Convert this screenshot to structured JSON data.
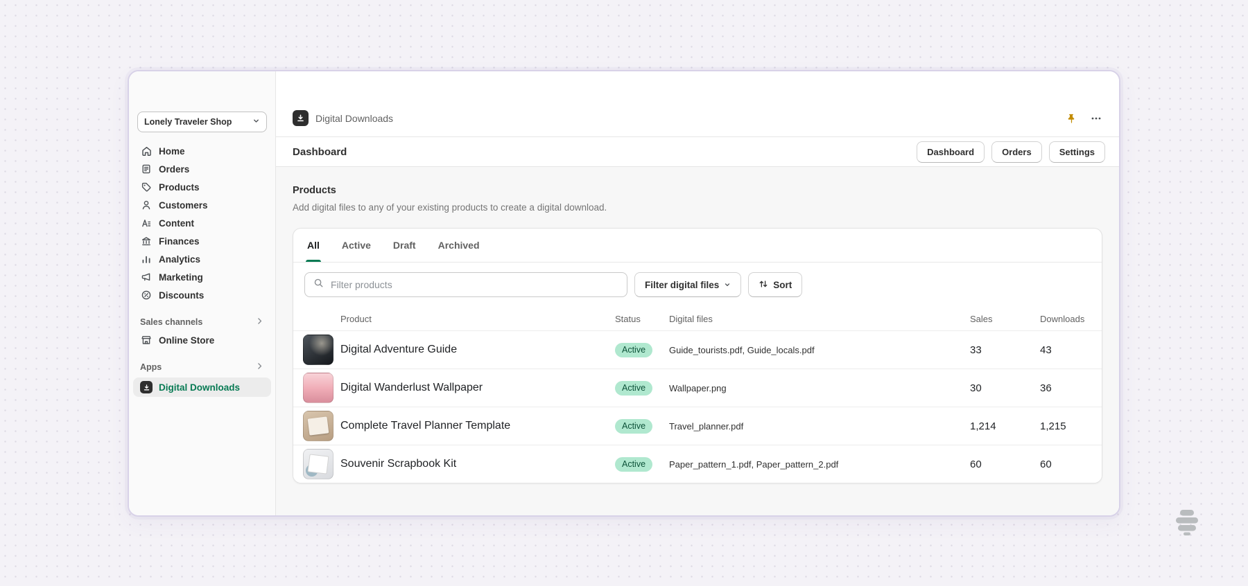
{
  "window": {
    "sidebar": {
      "store_selector": "Lonely Traveler Shop",
      "nav": [
        {
          "label": "Home",
          "icon": "home-icon"
        },
        {
          "label": "Orders",
          "icon": "orders-icon"
        },
        {
          "label": "Products",
          "icon": "products-icon"
        },
        {
          "label": "Customers",
          "icon": "customers-icon"
        },
        {
          "label": "Content",
          "icon": "content-icon"
        },
        {
          "label": "Finances",
          "icon": "finances-icon"
        },
        {
          "label": "Analytics",
          "icon": "analytics-icon"
        },
        {
          "label": "Marketing",
          "icon": "marketing-icon"
        },
        {
          "label": "Discounts",
          "icon": "discounts-icon"
        }
      ],
      "sales_channels": {
        "label": "Sales channels",
        "items": [
          "Online Store"
        ]
      },
      "apps": {
        "label": "Apps",
        "items": [
          "Digital Downloads"
        ],
        "active_item": "Digital Downloads"
      }
    },
    "header": {
      "app_name": "Digital Downloads"
    },
    "toolbar": {
      "title": "Dashboard",
      "nav_buttons": [
        "Dashboard",
        "Orders",
        "Settings"
      ]
    },
    "products": {
      "title": "Products",
      "description": "Add digital files to any of your existing products to create a digital download.",
      "tabs": [
        "All",
        "Active",
        "Draft",
        "Archived"
      ],
      "active_tab": "All",
      "filter_bar": {
        "search_placeholder": "Filter products",
        "filter_files_label": "Filter digital files",
        "sort_label": "Sort"
      },
      "table": {
        "columns": [
          "Product",
          "Status",
          "Digital files",
          "Sales",
          "Downloads"
        ],
        "rows": [
          {
            "name": "Digital Adventure Guide",
            "status": "Active",
            "files": "Guide_tourists.pdf, Guide_locals.pdf",
            "sales": "33",
            "downloads": "43"
          },
          {
            "name": "Digital Wanderlust Wallpaper",
            "status": "Active",
            "files": "Wallpaper.png",
            "sales": "30",
            "downloads": "36"
          },
          {
            "name": "Complete Travel Planner Template",
            "status": "Active",
            "files": "Travel_planner.pdf",
            "sales": "1,214",
            "downloads": "1,215"
          },
          {
            "name": "Souvenir Scrapbook Kit",
            "status": "Active",
            "files": "Paper_pattern_1.pdf, Paper_pattern_2.pdf",
            "sales": "60",
            "downloads": "60"
          }
        ]
      }
    }
  },
  "icons": {
    "search": "magnifier glyph",
    "pin": "amber pushpin",
    "more_options": "horizontal ellipsis dots",
    "sort": "up-down arrows",
    "chevron_down": "▾",
    "chevron_right": "›",
    "digital_downloads_app": "dark square with download-into-tray arrow",
    "watermark": "gray beehive"
  },
  "colors": {
    "accent_green": "#077a53",
    "badge_bg": "#b0e8cf",
    "badge_text": "#0c5138",
    "pin_amber": "#c28c00",
    "window_border": "#d8d2e8"
  }
}
